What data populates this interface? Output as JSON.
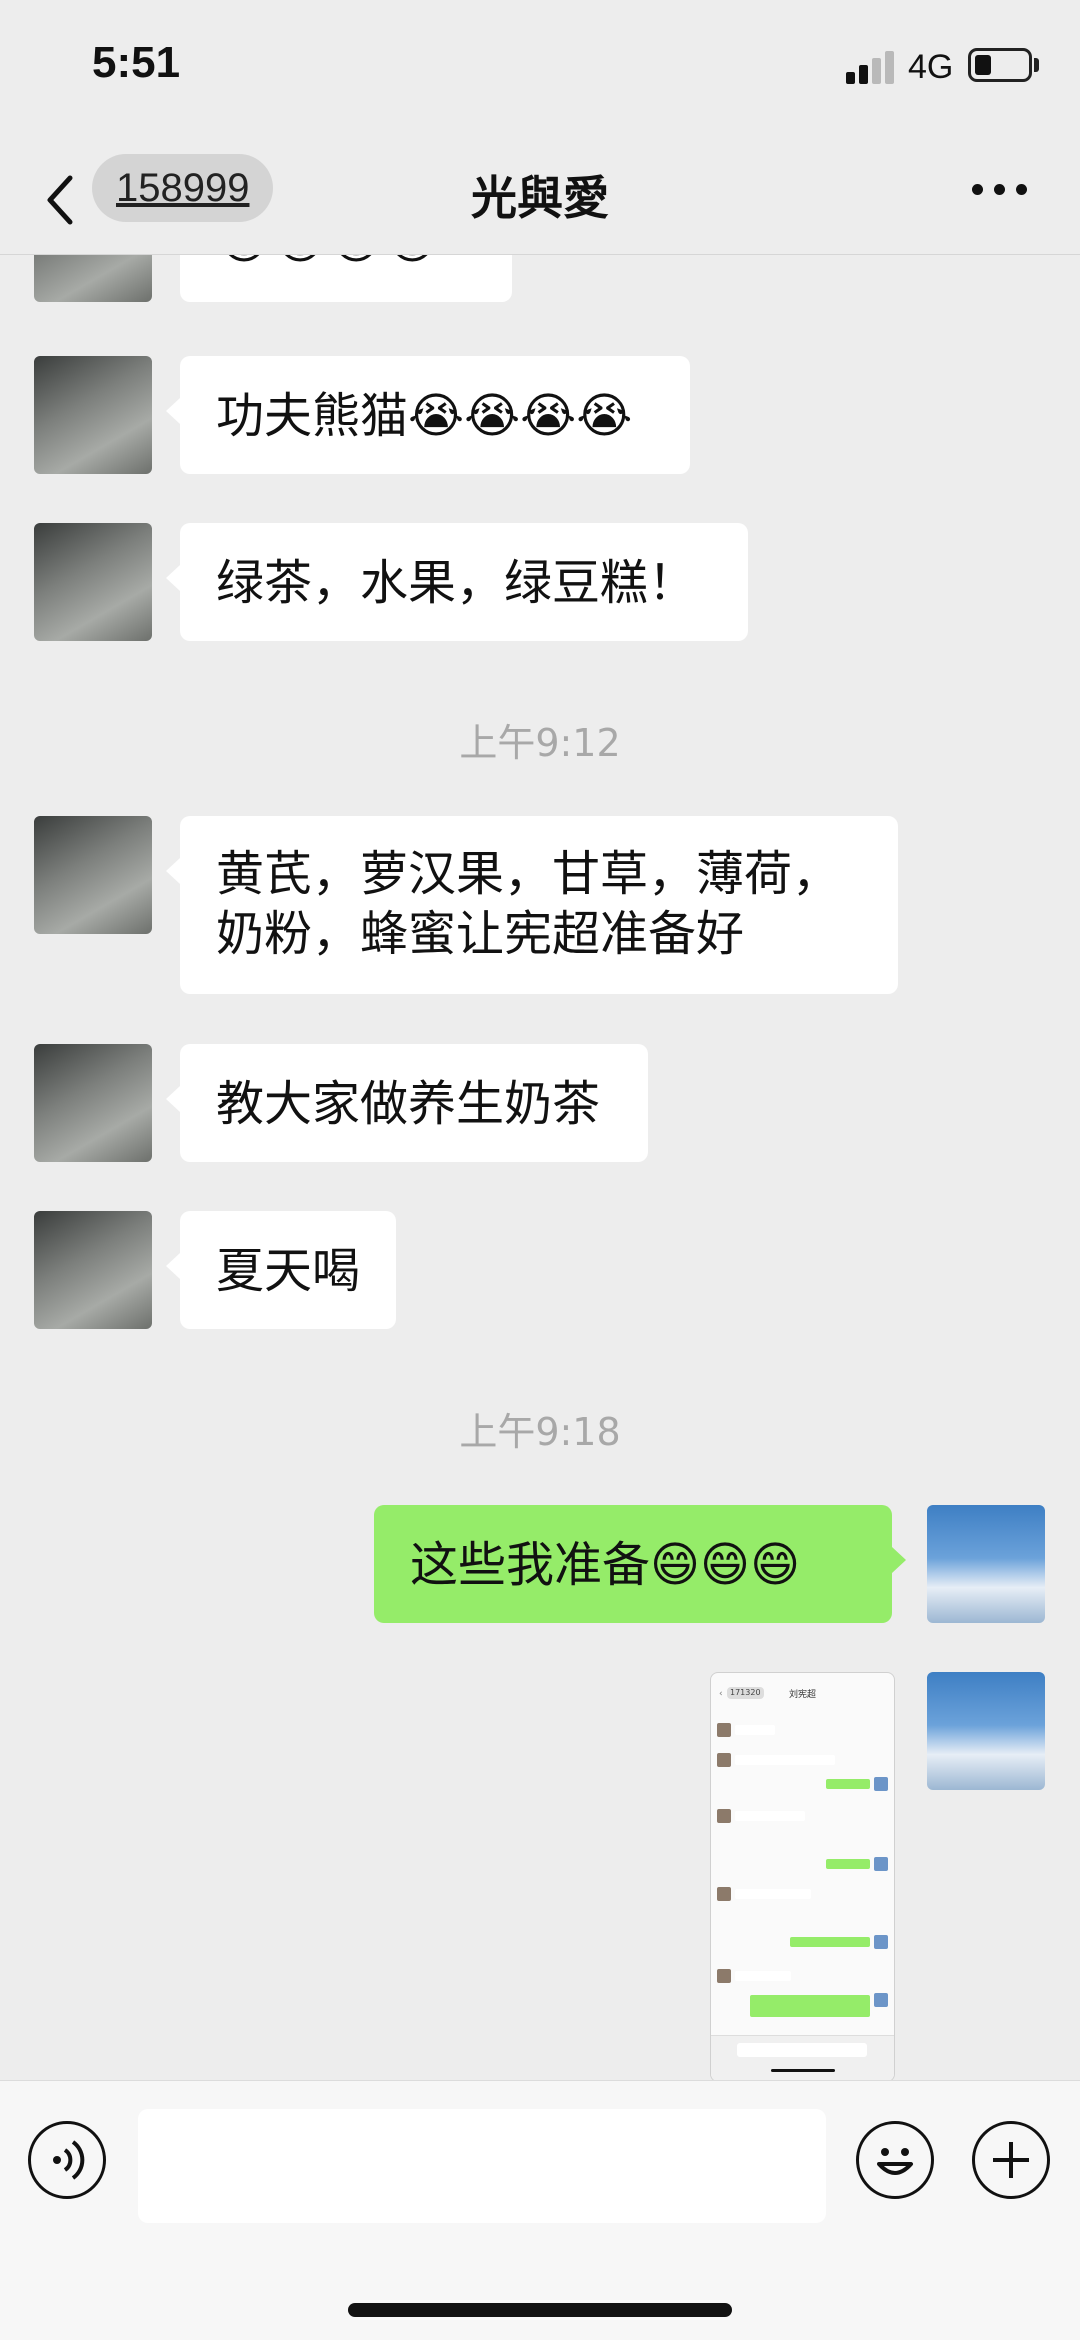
{
  "status_bar": {
    "time": "5:51",
    "network": "4G"
  },
  "nav": {
    "unread_count": "158999",
    "title": "光與愛"
  },
  "messages": [
    {
      "from": "other",
      "text": "😂😂😂😂",
      "partial": true
    },
    {
      "from": "other",
      "text": "功夫熊猫😭😭😭😭"
    },
    {
      "from": "other",
      "text": "绿茶，水果，绿豆糕！"
    },
    {
      "type": "time",
      "text": "上午9:12"
    },
    {
      "from": "other",
      "line1": "黄芪，萝汉果，甘草，薄荷，",
      "line2": "奶粉，蜂蜜让宪超准备好"
    },
    {
      "from": "other",
      "text": "教大家做养生奶茶"
    },
    {
      "from": "other",
      "text": "夏天喝"
    },
    {
      "type": "time",
      "text": "上午9:18"
    },
    {
      "from": "me",
      "text": "这些我准备😄😄😄"
    },
    {
      "from": "me",
      "type": "image",
      "image_title": "刘宪超",
      "image_badge": "171320"
    }
  ],
  "colors": {
    "background": "#ededed",
    "bubble_out": "#95ec69",
    "bubble_in": "#ffffff"
  }
}
